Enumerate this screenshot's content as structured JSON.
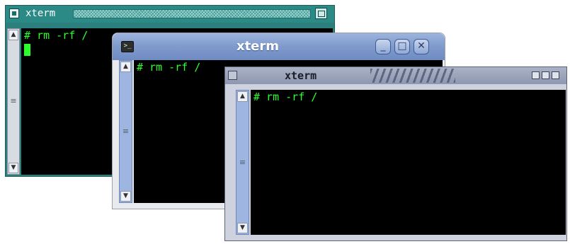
{
  "windows": [
    {
      "id": "w1",
      "title": "xterm",
      "prompt": "# rm -rf /",
      "icons": {
        "menu": "window-menu-icon",
        "maximize": "maximize-icon"
      }
    },
    {
      "id": "w2",
      "title": "xterm",
      "prompt": "# rm -rf /",
      "icons": {
        "app": "terminal-icon",
        "minimize": "minimize-icon",
        "maximize": "maximize-icon",
        "close": "close-icon"
      },
      "button_glyphs": {
        "minimize": "_",
        "maximize": "□",
        "close": "✕",
        "app": ">_"
      }
    },
    {
      "id": "w3",
      "title": "xterm",
      "prompt": "# rm -rf /"
    }
  ],
  "colors": {
    "terminal_bg": "#000000",
    "terminal_fg": "#2bff2b",
    "w1_titlebar": "#2b8a86",
    "w2_titlebar": "#7f9acc",
    "w3_titlebar": "#8e97b0"
  },
  "scrollbar_glyphs": {
    "up": "▲",
    "down": "▼",
    "grip": "≡"
  }
}
